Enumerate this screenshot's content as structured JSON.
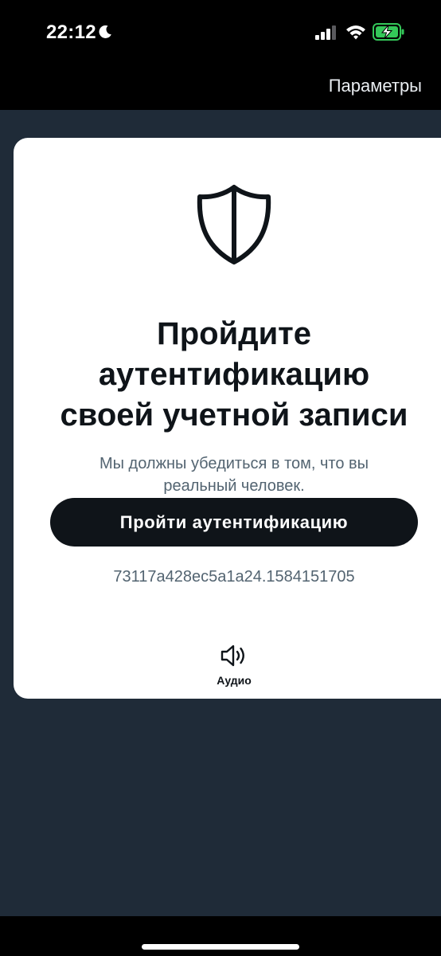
{
  "status_bar": {
    "time": "22:12",
    "focus_icon": "moon-icon",
    "signal_icon": "cellular-signal-icon",
    "wifi_icon": "wifi-icon",
    "battery_icon": "battery-charging-icon",
    "battery_color": "#34c759"
  },
  "nav": {
    "settings_label": "Параметры"
  },
  "card": {
    "icon": "shield-icon",
    "title_lines": [
      "Пройдите",
      "аутентификацию",
      "своей учетной записи"
    ],
    "subtitle_lines": [
      "Мы должны убедиться в том, что вы",
      "реальный человек."
    ],
    "button_label": "Пройти аутентификацию",
    "session_id": "73117a428ec5a1a24.1584151705",
    "audio_icon": "speaker-icon",
    "audio_label": "Аудио"
  },
  "colors": {
    "background": "#1f2b38",
    "card": "#ffffff",
    "primary_text": "#0f1419",
    "secondary_text": "#536471",
    "button": "#0f1419"
  }
}
